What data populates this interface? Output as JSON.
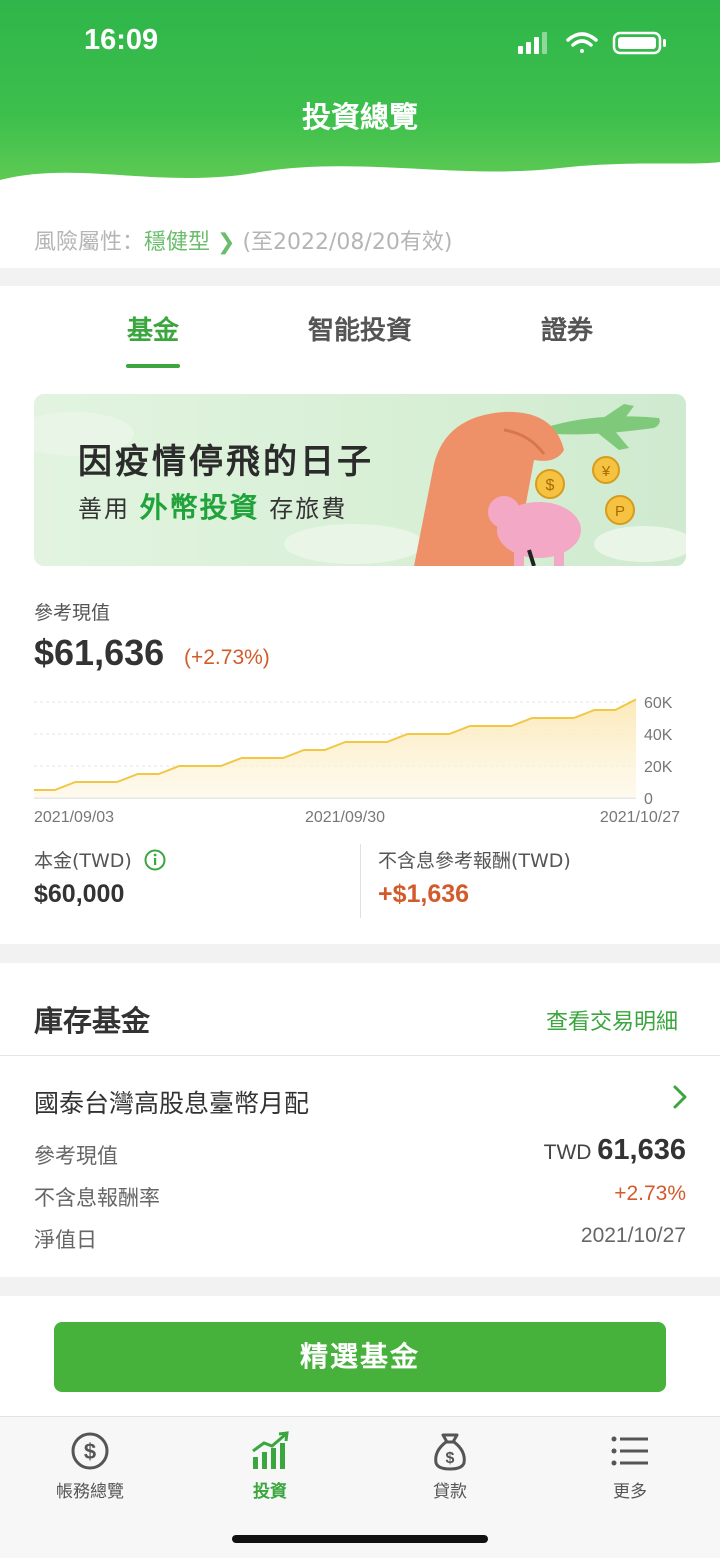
{
  "status_bar": {
    "time": "16:09"
  },
  "nav": {
    "title": "投資總覽"
  },
  "risk": {
    "label": "風險屬性：",
    "value": "穩健型",
    "validity": "(至2022/08/20有效)"
  },
  "tabs": [
    {
      "label": "基金",
      "active": true
    },
    {
      "label": "智能投資",
      "active": false
    },
    {
      "label": "證券",
      "active": false
    }
  ],
  "banner": {
    "headline": "因疫情停飛的日子",
    "sub_prefix": "善用",
    "sub_highlight": "外幣投資",
    "sub_suffix": "存旅費",
    "coins": [
      "$",
      "¥",
      "P"
    ]
  },
  "summary": {
    "value_label": "參考現值",
    "value": "$61,636",
    "change": "(+2.73%)",
    "principal_label": "本金(TWD)",
    "principal": "$60,000",
    "return_label": "不含息參考報酬(TWD)",
    "return": "+$1,636"
  },
  "chart_data": {
    "type": "area",
    "x_ticks": [
      "2021/09/03",
      "2021/09/30",
      "2021/10/27"
    ],
    "y_ticks": [
      "60K",
      "40K",
      "20K",
      "0"
    ],
    "ylim": [
      0,
      60000
    ],
    "values": [
      5000,
      5000,
      10000,
      10000,
      10000,
      15000,
      15000,
      20000,
      20000,
      20000,
      25000,
      25000,
      25000,
      30000,
      30000,
      35000,
      35000,
      35000,
      40000,
      40000,
      40000,
      45000,
      45000,
      45000,
      50000,
      50000,
      50000,
      55000,
      55000,
      61636
    ],
    "color": "#f2c744"
  },
  "holdings": {
    "title": "庫存基金",
    "link": "查看交易明細",
    "fund": {
      "name": "國泰台灣高股息臺幣月配",
      "rows": [
        {
          "label": "參考現值",
          "currency": "TWD",
          "value": "61,636"
        },
        {
          "label": "不含息報酬率",
          "value": "+2.73%"
        },
        {
          "label": "淨值日",
          "value": "2021/10/27"
        }
      ]
    }
  },
  "cta": {
    "label": "精選基金"
  },
  "tabbar": [
    {
      "label": "帳務總覽",
      "icon": "dollar-circle-icon",
      "active": false
    },
    {
      "label": "投資",
      "icon": "growth-chart-icon",
      "active": true
    },
    {
      "label": "貸款",
      "icon": "money-bag-icon",
      "active": false
    },
    {
      "label": "更多",
      "icon": "menu-list-icon",
      "active": false
    }
  ],
  "colors": {
    "brand": "#3aa63d",
    "negative_orange": "#d35a2a",
    "cta": "#46b23b"
  }
}
